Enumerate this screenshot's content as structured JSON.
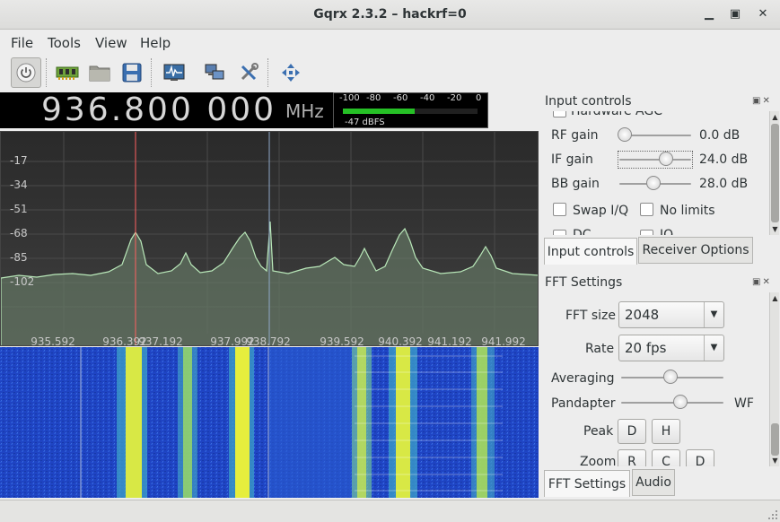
{
  "window": {
    "title": "Gqrx 2.3.2 – hackrf=0",
    "minimize_glyph": "▁",
    "maximize_glyph": "▣",
    "close_glyph": "✕"
  },
  "menu": {
    "file": "File",
    "tools": "Tools",
    "view": "View",
    "help": "Help"
  },
  "toolbar": {
    "icons": [
      "power-icon",
      "hardware-icon",
      "folder-icon",
      "save-icon",
      "fft-icon",
      "network-icon",
      "tools-icon",
      "move-icon"
    ]
  },
  "frequency": {
    "value": "936.800 000",
    "unit": "MHz"
  },
  "meter": {
    "scale": [
      "-100",
      "-80",
      "-60",
      "-40",
      "-20",
      "0"
    ],
    "reading": "-47 dBFS",
    "level_fraction": 0.53,
    "fill_color": "#26c026"
  },
  "spectrum": {
    "y_ticks": [
      "-17",
      "-34",
      "-51",
      "-68",
      "-85",
      "-102"
    ],
    "x_ticks": [
      "935.592",
      "936.392",
      "937.192",
      "937.992",
      "938.792",
      "939.592",
      "940.392",
      "941.192",
      "941.992"
    ],
    "background_color": "#333333",
    "trace_color": "#b9e8b9",
    "cursor_color": "#ff6060"
  },
  "input_controls": {
    "title": "Input controls",
    "hidden_row": "Hardware AGC",
    "rf_gain_label": "RF gain",
    "rf_gain_value": "0.0 dB",
    "if_gain_label": "IF gain",
    "if_gain_value": "24.0 dB",
    "bb_gain_label": "BB gain",
    "bb_gain_value": "28.0 dB",
    "swap_iq": "Swap I/Q",
    "no_limits": "No limits",
    "dc_partial": "DC",
    "iq_partial": "IQ"
  },
  "tabs_top": {
    "input_controls": "Input controls",
    "receiver_options": "Receiver Options"
  },
  "fft_settings": {
    "title": "FFT Settings",
    "fft_size_label": "FFT size",
    "fft_size_value": "2048",
    "rate_label": "Rate",
    "rate_value": "20 fps",
    "averaging_label": "Averaging",
    "pandapter_label": "Pandapter",
    "wf_label": "WF",
    "peak_label": "Peak",
    "peak_d": "D",
    "peak_h": "H",
    "zoom_label": "Zoom",
    "zoom_r": "R",
    "zoom_c": "C",
    "zoom_d": "D"
  },
  "tabs_bottom": {
    "fft_settings": "FFT Settings",
    "audio": "Audio"
  }
}
